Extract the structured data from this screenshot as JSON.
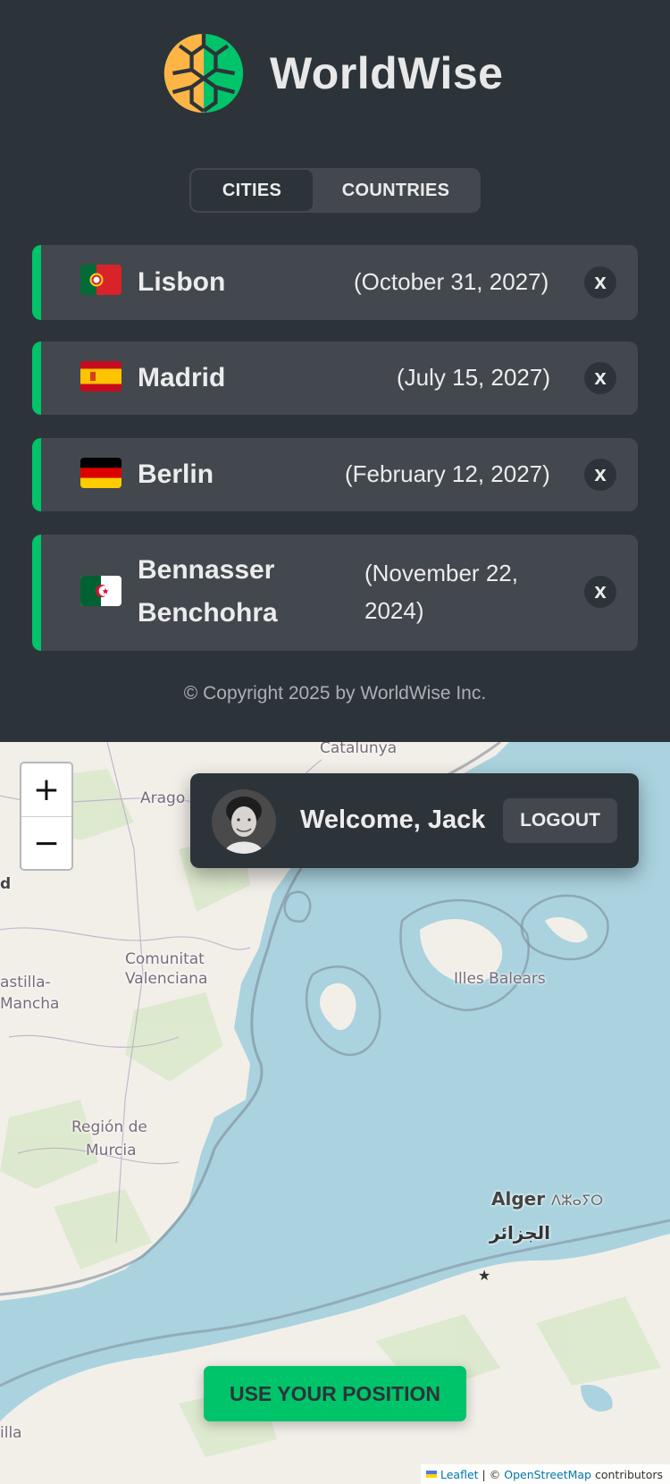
{
  "app": {
    "name": "WorldWise"
  },
  "tabs": [
    {
      "label": "CITIES",
      "active": true
    },
    {
      "label": "COUNTRIES",
      "active": false
    }
  ],
  "cities": [
    {
      "flag": "portugal-flag",
      "name": "Lisbon",
      "date": "(October 31, 2027)",
      "delete_label": "x"
    },
    {
      "flag": "spain-flag",
      "name": "Madrid",
      "date": "(July 15, 2027)",
      "delete_label": "x"
    },
    {
      "flag": "germany-flag",
      "name": "Berlin",
      "date": "(February 12, 2027)",
      "delete_label": "x"
    },
    {
      "flag": "algeria-flag",
      "name": "Bennasser Benchohra",
      "date": "(November 22, 2024)",
      "delete_label": "x"
    }
  ],
  "footer": {
    "copyright": "© Copyright 2025 by WorldWise Inc."
  },
  "map": {
    "zoom_in": "+",
    "zoom_out": "−",
    "labels": {
      "catalunya": "Catalunya",
      "aragon": "Arago",
      "d": "d",
      "comunitat": "Comunitat",
      "valenciana": "Valenciana",
      "castilla": "astilla-",
      "mancha": "Mancha",
      "illes": "Illes Balears",
      "region": "Región de",
      "murcia": "Murcia",
      "alger": "Alger",
      "alger_tifinagh": "ⴷⵣⴰⵢⵔ",
      "alger_ar": "الجزائر",
      "illa": "illa"
    },
    "attribution": {
      "leaflet": "Leaflet",
      "separator": "| ©",
      "osm": "OpenStreetMap",
      "contributors": "contributors"
    }
  },
  "user": {
    "welcome": "Welcome, Jack",
    "logout_label": "LOGOUT"
  },
  "use_position_label": "USE YOUR POSITION",
  "colors": {
    "brand_green": "#00c46a",
    "panel_dark": "#2d3439",
    "panel_light": "#42484d",
    "sea": "#aad3df",
    "land": "#f2efe9",
    "logo_orange": "#ffb545"
  }
}
